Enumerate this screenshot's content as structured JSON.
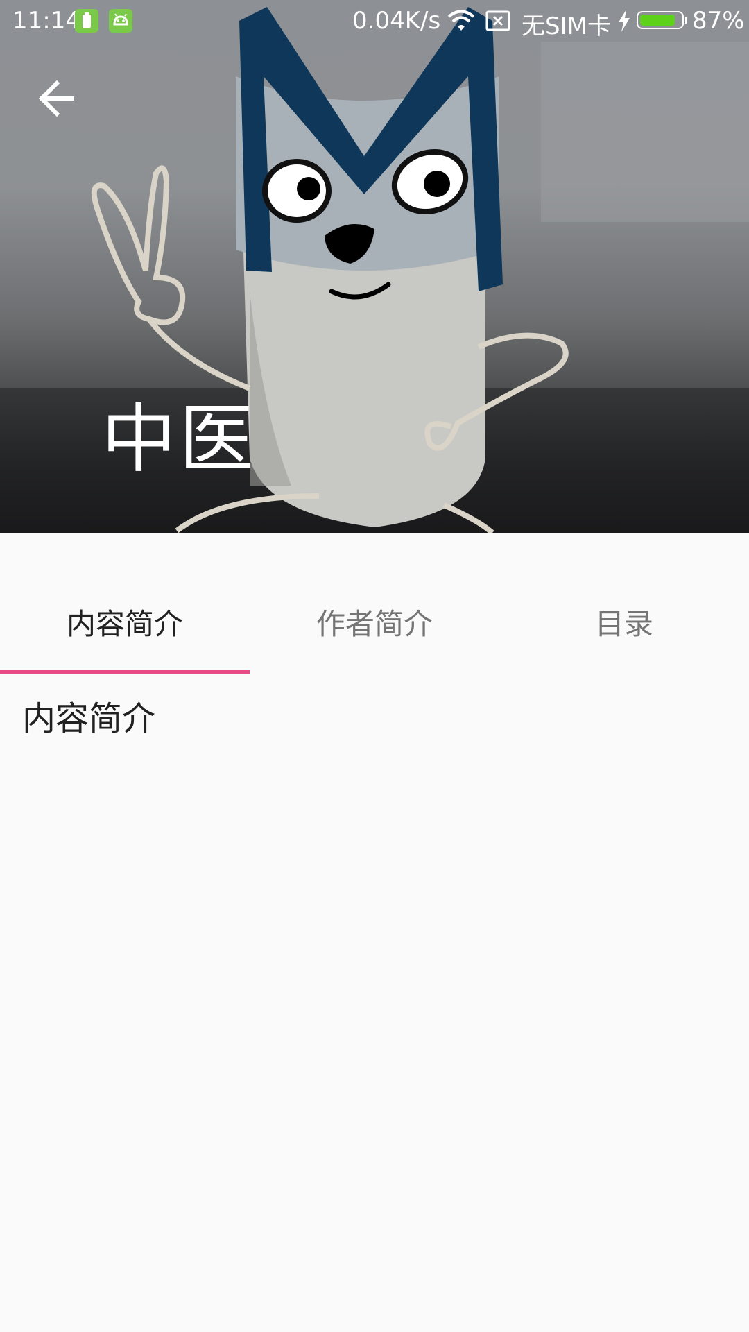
{
  "status_bar": {
    "time": "11:14",
    "net_speed": "0.04K/s",
    "carrier": "无SIM卡",
    "battery_percent_text": "87%",
    "battery_level": 0.87,
    "icons": [
      "battery-saver-app-icon",
      "android-app-icon",
      "wifi-icon",
      "no-sim-icon",
      "charging-icon",
      "battery-icon"
    ]
  },
  "toolbar": {
    "back_icon": "arrow-back-icon",
    "title": "中医"
  },
  "tabs": [
    {
      "label": "内容简介",
      "active": true
    },
    {
      "label": "作者简介",
      "active": false
    },
    {
      "label": "目录",
      "active": false
    }
  ],
  "content": {
    "text": "内容简介"
  },
  "colors": {
    "accent": "#e94b87",
    "background": "#fafafa",
    "tab_active_text": "#212121",
    "tab_inactive_text": "#757575",
    "battery_fill": "#5ed21a"
  }
}
